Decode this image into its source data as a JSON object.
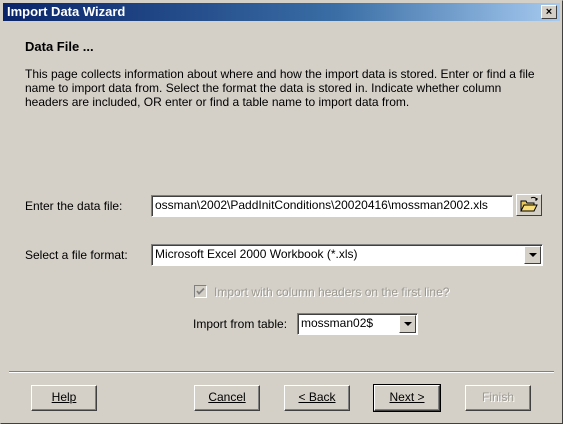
{
  "window": {
    "title": "Import Data Wizard",
    "close_glyph": "×"
  },
  "page": {
    "title": "Data File ...",
    "description": "This page collects information about where and how the import data is stored.  Enter or find a file name to import data from.  Select the format the data is stored in.  Indicate whether column headers are included, OR enter or find a table name to import data from."
  },
  "data_file": {
    "label": "Enter the data file:",
    "value": "ossman\\2002\\PaddInitConditions\\20020416\\mossman2002.xls",
    "browse_icon": "folder-open-icon"
  },
  "file_format": {
    "label": "Select a file format:",
    "selected": "Microsoft Excel 2000 Workbook (*.xls)"
  },
  "column_headers": {
    "label": "Import with column headers on the first line?",
    "checked": true,
    "enabled": false
  },
  "table": {
    "label": "Import from table:",
    "selected": "mossman02$"
  },
  "buttons": {
    "help": "Help",
    "cancel": "Cancel",
    "back": "< Back",
    "next": "Next >",
    "finish": "Finish"
  }
}
